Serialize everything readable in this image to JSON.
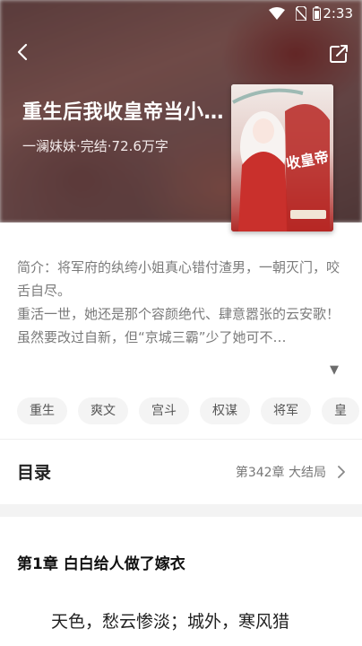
{
  "status_bar": {
    "time": "2:33"
  },
  "header": {
    "title": "重生后我收皇帝当小…",
    "meta": "一澜妹妹·完结·72.6万字"
  },
  "cover": {
    "text_main": "我收皇帝当小弟",
    "colors": {
      "red": "#c23a35",
      "dark": "#8e1d1d"
    }
  },
  "intro": {
    "line1": "简介：将军府的纨绔小姐真心错付渣男，一朝灭门，咬舌自尽。",
    "line2": "重活一世，她还是那个容颜绝代、肆意嚣张的云安歌！",
    "line3": "虽然要改过自新，但“京城三霸”少了她可不…",
    "more_glyph": "▼"
  },
  "tags": [
    "重生",
    "爽文",
    "宫斗",
    "权谋",
    "将军",
    "皇"
  ],
  "toc": {
    "title": "目录",
    "latest": "第342章 大结局"
  },
  "chapter": {
    "title": "第1章 白白给人做了嫁衣",
    "first_line": "天色，愁云惨淡；城外，寒风猎"
  }
}
